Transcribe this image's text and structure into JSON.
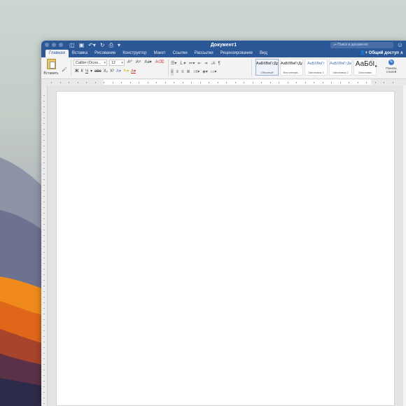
{
  "window": {
    "title": "Документ1",
    "search_placeholder": "Поиск в документе",
    "share_label": "Общий доступ"
  },
  "quick_access": [
    "sidebar",
    "save",
    "undo",
    "redo",
    "print",
    "customize"
  ],
  "tabs": [
    {
      "label": "Главная",
      "active": true
    },
    {
      "label": "Вставка"
    },
    {
      "label": "Рисование"
    },
    {
      "label": "Конструктор"
    },
    {
      "label": "Макет"
    },
    {
      "label": "Ссылки"
    },
    {
      "label": "Рассылки"
    },
    {
      "label": "Рецензирование"
    },
    {
      "label": "Вид"
    }
  ],
  "ribbon": {
    "paste_label": "Вставить",
    "font_name": "Calibri (Осно...",
    "font_size": "12",
    "bold": "Ж",
    "italic": "К",
    "underline": "Ч",
    "strike": "abc",
    "subscript": "X₂",
    "superscript": "X²",
    "styles": [
      {
        "preview": "АаБбВвГгДд",
        "name": "Обычный",
        "selected": true
      },
      {
        "preview": "АаБбВвГгДд",
        "name": "Без интерв..."
      },
      {
        "preview": "АаБбВвГг",
        "name": "Заголовок 1",
        "heading": true
      },
      {
        "preview": "АаБбВвГгДе",
        "name": "Заголовок 2",
        "heading": true
      },
      {
        "preview": "АаБбI",
        "name": "Заголовок",
        "big": true
      }
    ],
    "styles_pane_label": "Панель стилей"
  },
  "colors": {
    "titlebar": "#2b5797",
    "ribbon_bg": "#f3f3f3",
    "workspace_bg": "#e4e4e4"
  }
}
